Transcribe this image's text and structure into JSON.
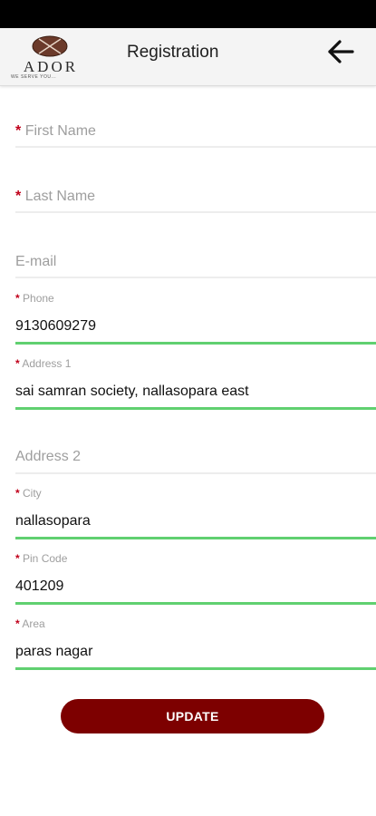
{
  "header": {
    "logo_text": "ADOR",
    "logo_tagline": "WE SERVE YOU...",
    "title": "Registration"
  },
  "form": {
    "first_name": {
      "placeholder": "First Name",
      "required": true,
      "value": ""
    },
    "last_name": {
      "placeholder": "Last Name",
      "required": true,
      "value": ""
    },
    "email": {
      "placeholder": "E-mail",
      "required": false,
      "value": ""
    },
    "phone": {
      "label": "Phone",
      "required": true,
      "value": "9130609279"
    },
    "address1": {
      "label": "Address 1",
      "required": true,
      "value": "sai samran society, nallasopara east"
    },
    "address2": {
      "placeholder": "Address 2",
      "required": false,
      "value": ""
    },
    "city": {
      "label": "City",
      "required": true,
      "value": "nallasopara"
    },
    "pincode": {
      "label": "Pin Code",
      "required": true,
      "value": "401209"
    },
    "area": {
      "label": "Area",
      "required": true,
      "value": "paras nagar"
    },
    "required_marker": "*"
  },
  "actions": {
    "update_label": "UPDATE"
  },
  "colors": {
    "accent": "#7d0000",
    "required": "#c0001a",
    "focus_underline": "#60d070"
  }
}
